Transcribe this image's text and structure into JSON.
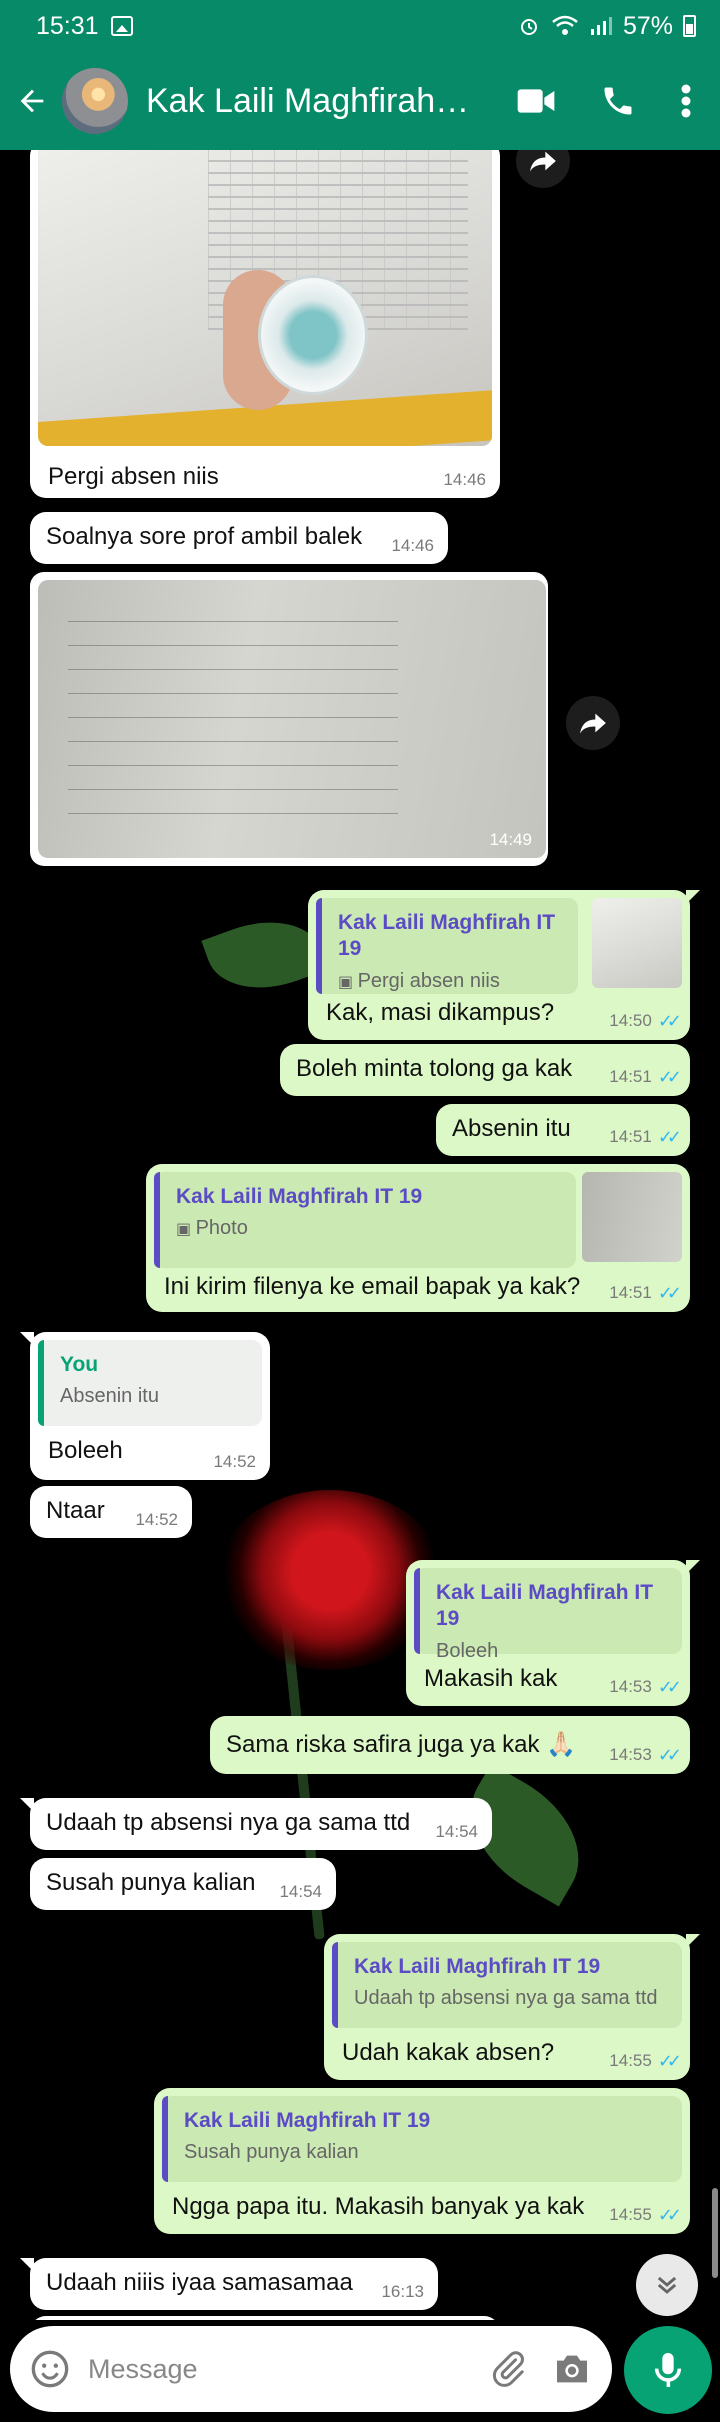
{
  "status": {
    "time": "15:31",
    "battery": "57%"
  },
  "header": {
    "contact_name": "Kak Laili Maghfirah…"
  },
  "messages": {
    "m1": {
      "text": "Pergi absen niis",
      "time": "14:46"
    },
    "m2": {
      "text": "Soalnya sore prof ambil balek",
      "time": "14:46"
    },
    "m3": {
      "time": "14:49"
    },
    "m4": {
      "quote_name": "Kak Laili Maghfirah IT 19",
      "quote_text": "Pergi absen niis",
      "text": "Kak, masi dikampus?",
      "time": "14:50"
    },
    "m5": {
      "text": "Boleh minta tolong ga kak",
      "time": "14:51"
    },
    "m6": {
      "text": "Absenin itu",
      "time": "14:51"
    },
    "m7": {
      "quote_name": "Kak Laili Maghfirah IT 19",
      "quote_text": "Photo",
      "text": "Ini kirim filenya ke email bapak ya kak?",
      "time": "14:51"
    },
    "m8": {
      "quote_name": "You",
      "quote_text": "Absenin itu",
      "text": "Boleeh",
      "time": "14:52"
    },
    "m9": {
      "text": "Ntaar",
      "time": "14:52"
    },
    "m10": {
      "quote_name": "Kak Laili Maghfirah IT 19",
      "quote_text": "Boleeh",
      "text": "Makasih kak",
      "time": "14:53"
    },
    "m11": {
      "text": "Sama riska safira juga ya kak 🙏🏻",
      "time": "14:53"
    },
    "m12": {
      "text": "Udaah tp absensi nya ga sama ttd",
      "time": "14:54"
    },
    "m13": {
      "text": "Susah punya kalian",
      "time": "14:54"
    },
    "m14": {
      "quote_name": "Kak Laili Maghfirah IT 19",
      "quote_text": "Udaah tp absensi nya ga sama ttd",
      "text": "Udah kakak absen?",
      "time": "14:55"
    },
    "m15": {
      "quote_name": "Kak Laili Maghfirah IT 19",
      "quote_text": "Susah punya kalian",
      "text": "Ngga papa itu. Makasih banyak ya kak",
      "time": "14:55"
    },
    "m16": {
      "text": "Udaah niiis iyaa samasamaa",
      "time": "16:13"
    }
  },
  "input": {
    "placeholder": "Message"
  },
  "colors": {
    "header": "#078a68",
    "outgoing": "#dcf8c6",
    "incoming": "#ffffff",
    "accent": "#07a374",
    "ticks": "#34b7f1",
    "quote_name": "#5b4bc4"
  },
  "icons": [
    "back-arrow-icon",
    "video-call-icon",
    "phone-icon",
    "more-vert-icon",
    "forward-icon",
    "emoji-icon",
    "attach-icon",
    "camera-icon",
    "mic-icon",
    "scroll-down-icon",
    "photo-icon"
  ]
}
